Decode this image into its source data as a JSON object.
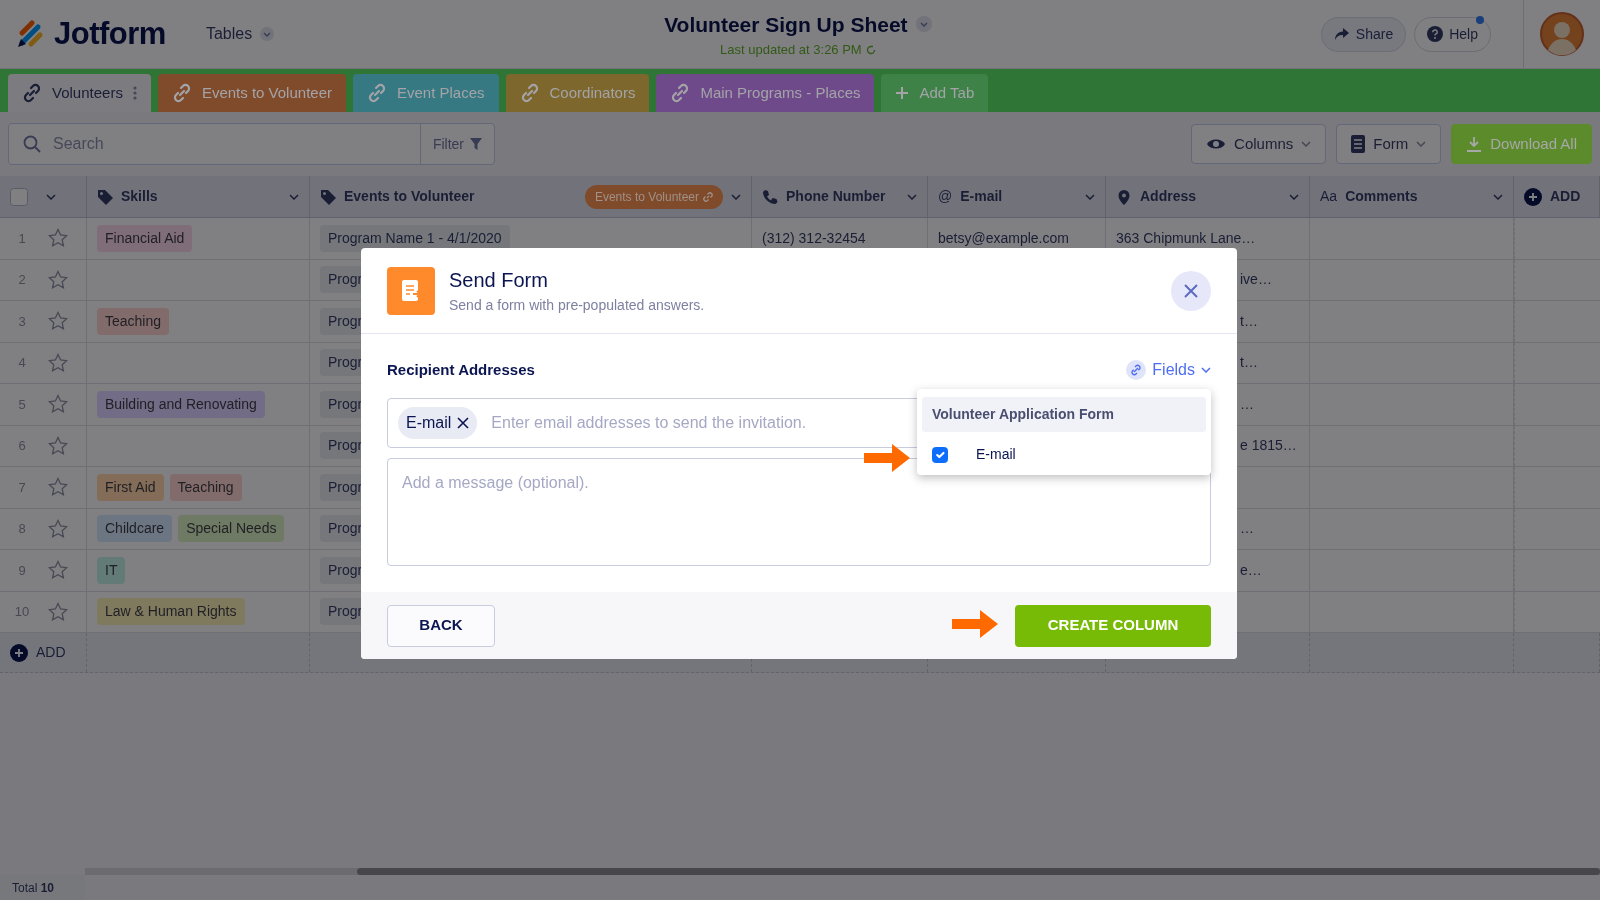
{
  "header": {
    "logo_text": "Jotform",
    "app_menu": "Tables",
    "title": "Volunteer Sign Up Sheet",
    "subtitle": "Last updated at 3:26 PM",
    "share": "Share",
    "help": "Help"
  },
  "tabs": [
    {
      "label": "Volunteers",
      "color": "#7b7b80",
      "selected": true
    },
    {
      "label": "Events to Volunteer",
      "color": "#7f4b2b",
      "selected": false
    },
    {
      "label": "Event Places",
      "color": "#367982",
      "selected": false
    },
    {
      "label": "Coordinators",
      "color": "#7e672c",
      "selected": false
    },
    {
      "label": "Main Programs - Places",
      "color": "#6e4a8a",
      "selected": false
    }
  ],
  "add_tab": "Add Tab",
  "toolbar": {
    "search_placeholder": "Search",
    "filter": "Filter",
    "columns": "Columns",
    "form": "Form",
    "download": "Download All"
  },
  "table": {
    "select_all": {
      "checked": false
    },
    "columns": [
      {
        "label": "Skills",
        "kind": "tag"
      },
      {
        "label": "Events to Volunteer",
        "kind": "tag",
        "badge": "Events to Volunteer"
      },
      {
        "label": "Phone Number",
        "kind": "phone"
      },
      {
        "label": "E-mail",
        "kind": "glyph",
        "glyph": "@"
      },
      {
        "label": "Address",
        "kind": "pin"
      },
      {
        "label": "Comments",
        "kind": "glyph",
        "glyph": "Aa"
      }
    ],
    "add_column": "ADD",
    "rows": [
      {
        "number": "1",
        "skills": [
          {
            "label": "Financial Aid",
            "color": "#7f6e79"
          }
        ],
        "event": "Program Name 1 - 4/1/2020",
        "phone": "(312) 312-32454",
        "email": "betsy@example.com",
        "address": "363 Chipmunk Lane…",
        "address_cut": false
      },
      {
        "number": "2",
        "skills": [],
        "event": "Progr",
        "address": "ive…",
        "address_cut": true
      },
      {
        "number": "3",
        "skills": [
          {
            "label": "Teaching",
            "color": "#826b6b"
          }
        ],
        "event": "Progr",
        "address": "t…",
        "address_cut": true
      },
      {
        "number": "4",
        "skills": [],
        "event": "Progr",
        "address": "t…",
        "address_cut": true
      },
      {
        "number": "5",
        "skills": [
          {
            "label": "Building and Renovating",
            "color": "#726c86"
          }
        ],
        "event": "Progr",
        "address": "…",
        "address_cut": true
      },
      {
        "number": "6",
        "skills": [],
        "event": "Progr",
        "address": "e 1815…",
        "address_cut": true
      },
      {
        "number": "7",
        "skills": [
          {
            "label": "First Aid",
            "color": "#846d58"
          },
          {
            "label": "Teaching",
            "color": "#826b6b"
          }
        ],
        "event": "Progr"
      },
      {
        "number": "8",
        "skills": [
          {
            "label": "Childcare",
            "color": "#6c7582"
          },
          {
            "label": "Special Needs",
            "color": "#6f7a64"
          }
        ],
        "event": "Progr",
        "address": "…",
        "address_cut": true
      },
      {
        "number": "9",
        "skills": [
          {
            "label": "IT",
            "color": "#627b77"
          }
        ],
        "event": "Progr",
        "address": "e…",
        "address_cut": true
      },
      {
        "number": "10",
        "skills": [
          {
            "label": "Law & Human Rights",
            "color": "#7f7a5e"
          }
        ],
        "event": "Progr"
      }
    ],
    "add_row": "ADD"
  },
  "footer": {
    "total": "Total **10**"
  },
  "modal": {
    "title": "Send Form",
    "subtitle": "Send a form with pre-populated answers.",
    "section": "Recipient Addresses",
    "fields_button": "Fields",
    "chips": [
      {
        "label": "E-mail"
      }
    ],
    "recipient_placeholder": "Enter email addresses to send the invitation.",
    "message_placeholder": "Add a message (optional).",
    "dropdown": {
      "heading": "Volunteer Application Form",
      "options": [
        {
          "label": "E-mail",
          "checked": true
        }
      ]
    },
    "back": "BACK",
    "create": "CREATE COLUMN"
  }
}
